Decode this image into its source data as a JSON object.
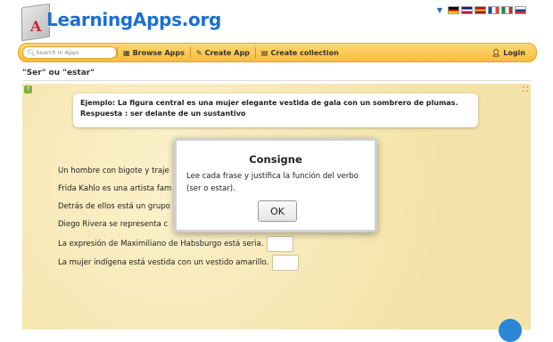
{
  "header": {
    "logo_text": "LearningApps.org",
    "languages": [
      {
        "name": "de-flag",
        "colors": [
          "#000000",
          "#dd0000",
          "#ffce00"
        ]
      },
      {
        "name": "en-flag",
        "colors": [
          "#012169",
          "#ffffff",
          "#c8102e"
        ]
      },
      {
        "name": "es-flag",
        "colors": [
          "#aa151b",
          "#f1bf00",
          "#aa151b"
        ]
      },
      {
        "name": "fr-flag",
        "colors": [
          "#0055a4",
          "#ffffff",
          "#ef4135"
        ]
      },
      {
        "name": "it-flag",
        "colors": [
          "#009246",
          "#ffffff",
          "#ce2b37"
        ]
      },
      {
        "name": "ru-flag",
        "colors": [
          "#ffffff",
          "#0039a6",
          "#d52b1e"
        ]
      }
    ]
  },
  "nav": {
    "search_placeholder": "Search in Apps",
    "browse_label": "Browse Apps",
    "create_label": "Create App",
    "collection_label": "Create collection",
    "login_label": "Login"
  },
  "page": {
    "title": "\"Ser\" ou \"estar\""
  },
  "app": {
    "example": "Ejemplo: La figura central es una mujer elegante vestida de gala con un sombrero de plumas. Respuesta : ser delante de un sustantivo",
    "sentences": [
      "Un hombre con bigote y traje",
      "Frida Kahlo es una artista fam",
      "Detrás de ellos está un grupo",
      "Diego Rivera se representa c",
      "La expresión de Maximiliano de Habsburgo está seria.",
      "La mujer indígena está vestida con un vestido amarillo."
    ]
  },
  "modal": {
    "title": "Consigne",
    "text": "Lee cada frase y justifica la función del verbo (ser o estar).",
    "ok_label": "OK"
  },
  "colors": {
    "accent": "#f5bd3c",
    "app_background": "#f6e9b9",
    "logo_blue": "#1d6fd0"
  }
}
